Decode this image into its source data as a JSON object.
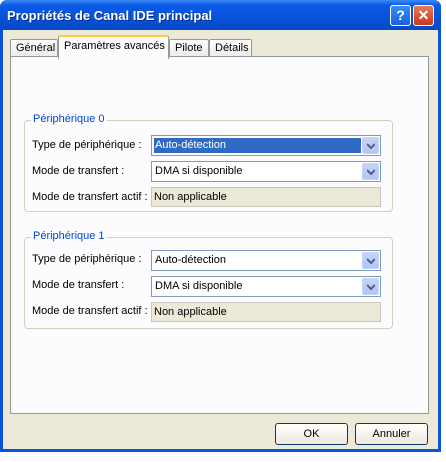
{
  "window": {
    "title": "Propriétés de Canal IDE principal"
  },
  "titlebar_buttons": {
    "help": "?",
    "close": "✕"
  },
  "tabs": [
    {
      "label": "Général"
    },
    {
      "label": "Paramètres avancés"
    },
    {
      "label": "Pilote"
    },
    {
      "label": "Détails"
    }
  ],
  "device0": {
    "title": "Périphérique 0",
    "type_label": "Type de périphérique :",
    "type_value": "Auto-détection",
    "mode_label": "Mode de transfert :",
    "mode_value": "DMA si disponible",
    "active_label": "Mode de transfert actif :",
    "active_value": "Non applicable"
  },
  "device1": {
    "title": "Périphérique 1",
    "type_label": "Type de périphérique :",
    "type_value": "Auto-détection",
    "mode_label": "Mode de transfert :",
    "mode_value": "DMA si disponible",
    "active_label": "Mode de transfert actif :",
    "active_value": "Non applicable"
  },
  "buttons": {
    "ok": "OK",
    "cancel": "Annuler"
  }
}
